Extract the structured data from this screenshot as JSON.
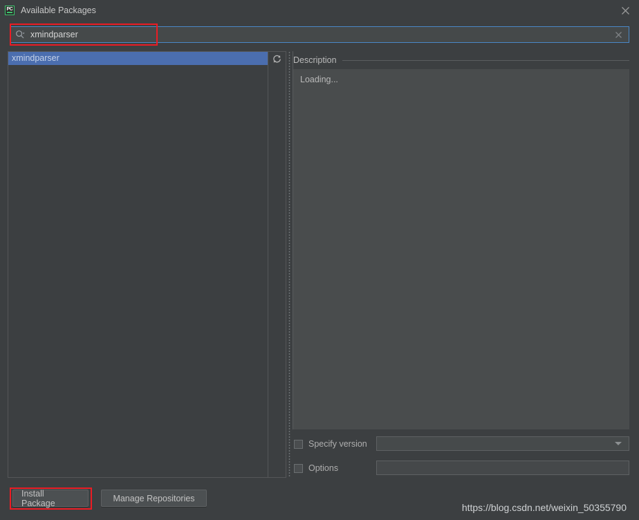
{
  "window": {
    "title": "Available Packages",
    "app_icon": "pycharm-icon",
    "icon_text": "PC",
    "close_icon": "close-icon",
    "accent_blue": "#4a88c7",
    "selection_blue": "#4b6eaf",
    "annotation_red": "#ec1c24",
    "background": "#3c3f41"
  },
  "search": {
    "icon": "search-icon",
    "value": "xmindparser",
    "placeholder": "",
    "clear_icon": "clear-icon"
  },
  "package_list": {
    "refresh_icon": "refresh-icon",
    "items": [
      {
        "label": "xmindparser",
        "selected": true
      }
    ]
  },
  "description": {
    "title": "Description",
    "body": "Loading..."
  },
  "options": {
    "specify_version": {
      "label": "Specify version",
      "checked": false,
      "value": "",
      "dropdown_icon": "chevron-down-icon"
    },
    "options_field": {
      "label": "Options",
      "checked": false,
      "value": ""
    }
  },
  "buttons": {
    "install": "Install Package",
    "manage": "Manage Repositories"
  },
  "watermark": {
    "text": "https://blog.csdn.net/weixin_50355790"
  }
}
